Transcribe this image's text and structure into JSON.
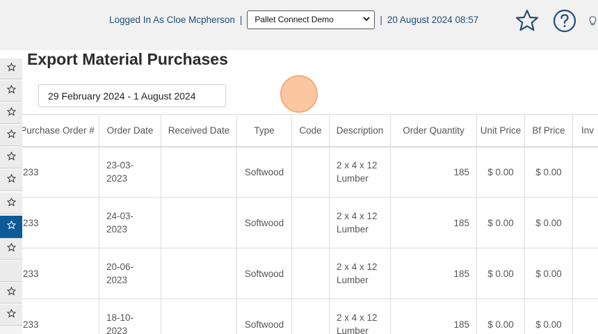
{
  "header": {
    "logged_in_text": "Logged In As Cloe Mcpherson",
    "separator": "|",
    "company_selected": "Pallet Connect Demo",
    "datetime": "20 August 2024 08:57",
    "icons": [
      "star-icon",
      "help-icon",
      "lightbulb-icon"
    ]
  },
  "sidebar": {
    "items": [
      {
        "icon": "star-icon",
        "active": false
      },
      {
        "icon": "star-icon",
        "active": false
      },
      {
        "icon": "star-icon",
        "active": false
      },
      {
        "icon": "star-icon",
        "active": false
      },
      {
        "icon": "star-icon",
        "active": false
      },
      {
        "icon": "star-icon",
        "active": false
      },
      {
        "icon": "star-icon",
        "active": false
      },
      {
        "icon": "star-icon",
        "active": true
      },
      {
        "icon": "star-icon",
        "active": false
      },
      {
        "icon": "",
        "active": false
      },
      {
        "icon": "star-icon",
        "active": false
      },
      {
        "icon": "star-icon",
        "active": false
      }
    ]
  },
  "page": {
    "title": "Export Material Purchases",
    "date_range": "29 February 2024 - 1 August 2024"
  },
  "table": {
    "headers": [
      "Purchase Order #",
      "Order Date",
      "Received Date",
      "Type",
      "Code",
      "Description",
      "Order Quantity",
      "Unit Price",
      "Bf Price",
      "Inv"
    ],
    "rows": [
      {
        "po": "233",
        "order_date": "23-03-2023",
        "received_date": "",
        "type": "Softwood",
        "code": "",
        "description": "2 x 4 x 12 Lumber",
        "qty": "185",
        "unit_price": "$ 0.00",
        "bf_price": "$ 0.00",
        "inv": ""
      },
      {
        "po": "233",
        "order_date": "24-03-2023",
        "received_date": "",
        "type": "Softwood",
        "code": "",
        "description": "2 x 4 x 12 Lumber",
        "qty": "185",
        "unit_price": "$ 0.00",
        "bf_price": "$ 0.00",
        "inv": ""
      },
      {
        "po": "233",
        "order_date": "20-06-2023",
        "received_date": "",
        "type": "Softwood",
        "code": "",
        "description": "2 x 4 x 12 Lumber",
        "qty": "185",
        "unit_price": "$ 0.00",
        "bf_price": "$ 0.00",
        "inv": ""
      },
      {
        "po": "233",
        "order_date": "18-10-2023",
        "received_date": "",
        "type": "Softwood",
        "code": "",
        "description": "2 x 4 x 12 Lumber",
        "qty": "185",
        "unit_price": "$ 0.00",
        "bf_price": "$ 0.00",
        "inv": ""
      }
    ]
  },
  "colors": {
    "accent": "#0e5a96",
    "link_text": "#1f4e79",
    "icon_stroke": "#1f4e79",
    "cursor_highlight": "#f7b58a"
  }
}
